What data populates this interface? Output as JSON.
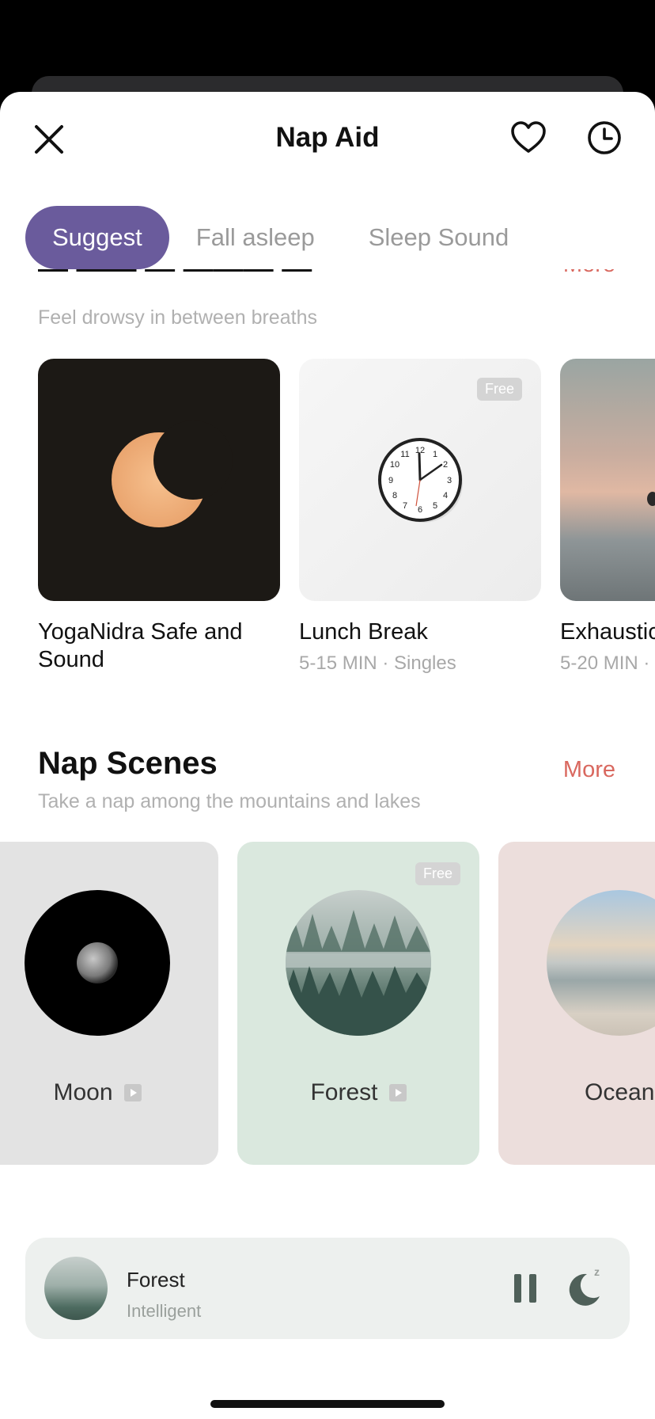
{
  "header": {
    "title": "Nap Aid"
  },
  "tabs": [
    {
      "label": "Suggest",
      "active": true
    },
    {
      "label": "Fall asleep",
      "active": false
    },
    {
      "label": "Sleep Sound",
      "active": false
    }
  ],
  "section1": {
    "subtitle": "Feel drowsy in between breaths",
    "more_label": "More",
    "cards": [
      {
        "title": "YogaNidra Safe and Sound",
        "meta": ""
      },
      {
        "title": "Lunch Break",
        "meta": "5-15 MIN · Singles",
        "badge": "Free"
      },
      {
        "title": "Exhaustic",
        "meta": "5-20 MIN ·"
      }
    ]
  },
  "section2": {
    "title": "Nap Scenes",
    "subtitle": "Take a nap among the mountains and lakes",
    "more_label": "More",
    "scenes": [
      {
        "label": "Moon",
        "bg": "#e3e3e3"
      },
      {
        "label": "Forest",
        "bg": "#dae8de",
        "badge": "Free"
      },
      {
        "label": "Ocean",
        "bg": "#ecdedc"
      }
    ]
  },
  "player": {
    "title": "Forest",
    "subtitle": "Intelligent"
  },
  "colors": {
    "accent": "#6a5b9c",
    "more": "#d9685f"
  },
  "icons": [
    "close-icon",
    "heart-icon",
    "clock-icon",
    "pause-icon",
    "moon-sleep-icon",
    "play-icon"
  ]
}
